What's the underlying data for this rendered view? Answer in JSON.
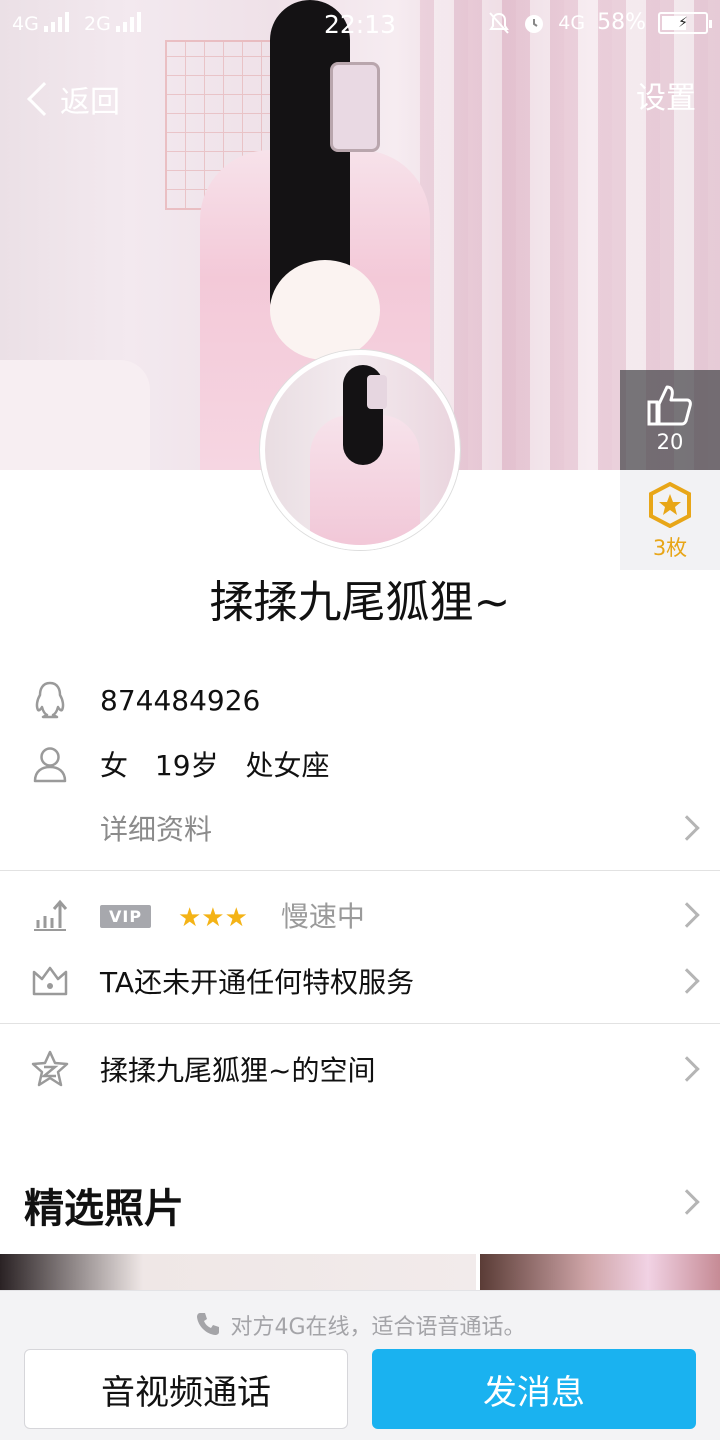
{
  "status_bar": {
    "sim1": "4G",
    "sim2": "2G",
    "time": "22:13",
    "network": "4G",
    "battery": "58%",
    "battery_level": 0.58
  },
  "nav": {
    "back_label": "返回",
    "settings_label": "设置"
  },
  "side_panel": {
    "likes_count": "20",
    "medals_label": "3枚"
  },
  "profile": {
    "nickname": "揉揉九尾狐狸~",
    "qq_number": "874484926",
    "gender": "女",
    "age": "19岁",
    "constellation": "处女座",
    "details_link": "详细资料"
  },
  "vip": {
    "badge": "VIP",
    "stars": "★★★",
    "status": "慢速中",
    "privilege_text": "TA还未开通任何特权服务"
  },
  "space": {
    "label": "揉揉九尾狐狸~的空间"
  },
  "photos": {
    "title": "精选照片"
  },
  "bottom_bar": {
    "hint": "对方4G在线，适合语音通话。",
    "call_button": "音视频通话",
    "message_button": "发消息"
  },
  "colors": {
    "accent": "#1ab2f0",
    "medal": "#e8a618",
    "star": "#f4b316"
  }
}
